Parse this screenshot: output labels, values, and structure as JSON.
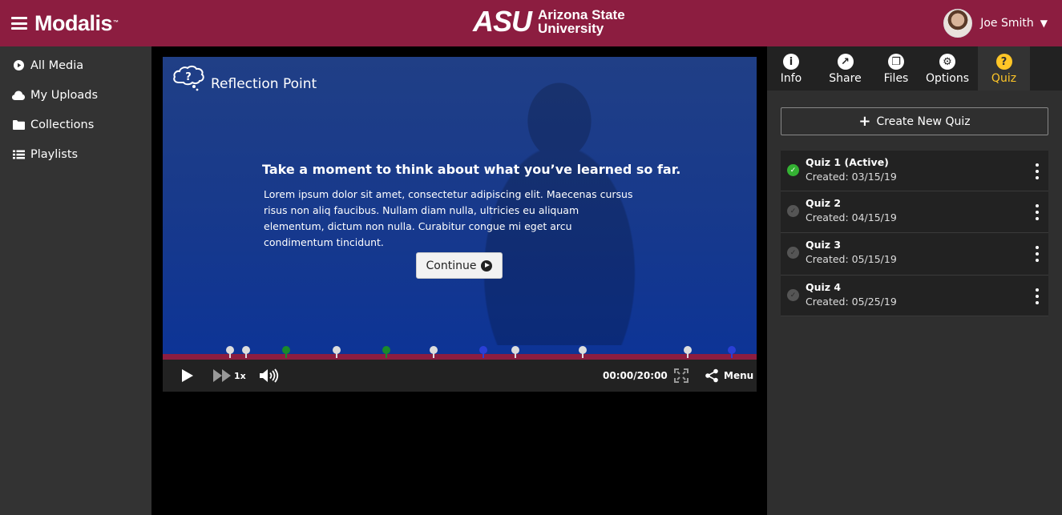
{
  "topbar": {
    "brand": "Modalis",
    "brand_tm": "™",
    "org_mark": "ASU",
    "org_line1": "Arizona State",
    "org_line2": "University",
    "user_name": "Joe Smith",
    "bg_color": "#8c1d40"
  },
  "sidebar": {
    "items": [
      {
        "label": "All Media",
        "icon": "play-circle-icon"
      },
      {
        "label": "My Uploads",
        "icon": "cloud-icon"
      },
      {
        "label": "Collections",
        "icon": "folder-icon"
      },
      {
        "label": "Playlists",
        "icon": "list-icon"
      }
    ]
  },
  "player": {
    "overlay_title": "Reflection Point",
    "message_title": "Take a moment to think about what you’ve learned so far.",
    "message_body": "Lorem ipsum dolor sit amet, consectetur adipiscing elit. Maecenas cursus risus non aliq faucibus. Nullam diam nulla, ultricies eu aliquam elementum, dictum non nulla. Curabitur congue mi eget arcu condimentum tincidunt.",
    "continue_label": "Continue",
    "speed": "1x",
    "time": "00:00/20:00",
    "menu_label": "Menu",
    "progress": 0,
    "markers": [
      {
        "at": 0.113,
        "color": "#dddddd"
      },
      {
        "at": 0.14,
        "color": "#dddddd"
      },
      {
        "at": 0.208,
        "color": "#1a8a2a"
      },
      {
        "at": 0.293,
        "color": "#dddddd"
      },
      {
        "at": 0.377,
        "color": "#1a8a2a"
      },
      {
        "at": 0.456,
        "color": "#dddddd"
      },
      {
        "at": 0.54,
        "color": "#2a3fd6"
      },
      {
        "at": 0.594,
        "color": "#dddddd"
      },
      {
        "at": 0.707,
        "color": "#dddddd"
      },
      {
        "at": 0.884,
        "color": "#dddddd"
      },
      {
        "at": 0.958,
        "color": "#2a3fd6"
      }
    ]
  },
  "rpanel": {
    "tabs": [
      {
        "label": "Info",
        "icon": "info-icon",
        "glyph": "i"
      },
      {
        "label": "Share",
        "icon": "share-icon",
        "glyph": "↗"
      },
      {
        "label": "Files",
        "icon": "files-icon",
        "glyph": "❐"
      },
      {
        "label": "Options",
        "icon": "gear-icon",
        "glyph": "⚙"
      },
      {
        "label": "Quiz",
        "icon": "question-icon",
        "glyph": "?"
      }
    ],
    "active_tab": "Quiz",
    "create_label": "Create New Quiz",
    "quizzes": [
      {
        "title": "Quiz 1 (Active)",
        "created": "Created: 03/15/19",
        "active": true
      },
      {
        "title": "Quiz 2",
        "created": "Created: 04/15/19",
        "active": false
      },
      {
        "title": "Quiz 3",
        "created": "Created: 05/15/19",
        "active": false
      },
      {
        "title": "Quiz 4",
        "created": "Created: 05/25/19",
        "active": false
      }
    ]
  }
}
